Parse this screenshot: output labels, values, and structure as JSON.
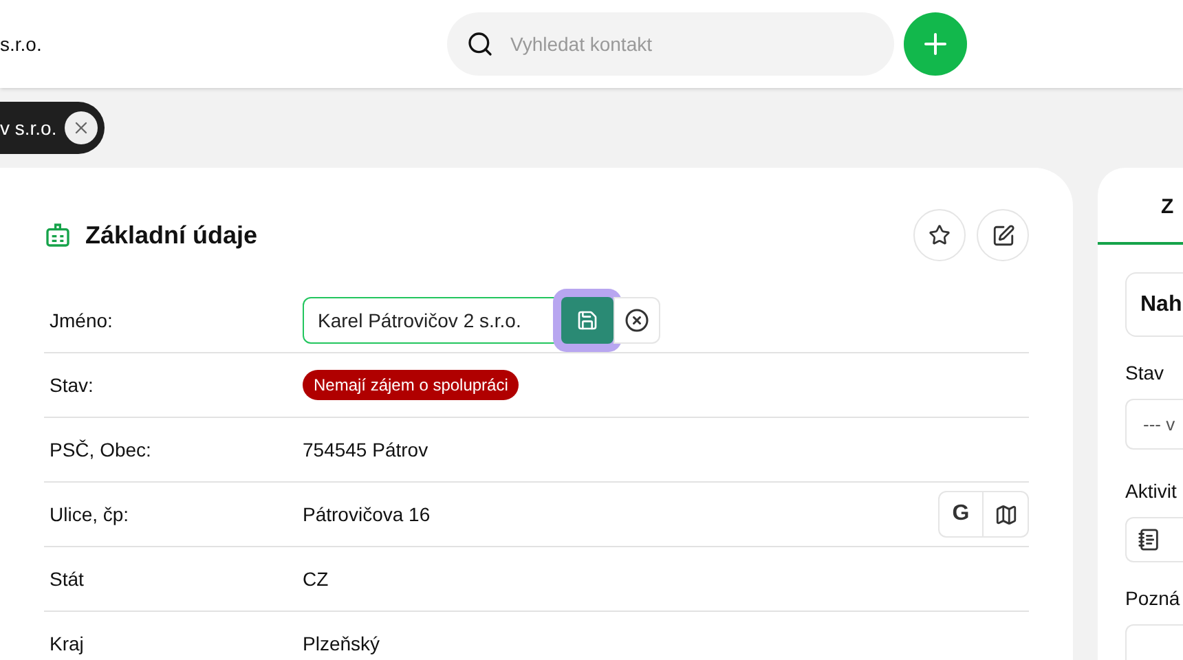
{
  "header": {
    "title": "s.r.o.",
    "search": {
      "placeholder": "Vyhledat kontakt"
    }
  },
  "chips": [
    {
      "label": "v s.r.o."
    }
  ],
  "card": {
    "title": "Základní údaje",
    "rows": [
      {
        "kind": "input",
        "label": "Jméno:",
        "value": "Karel Pátrovičov 2 s.r.o."
      },
      {
        "kind": "badge",
        "label": "Stav:",
        "value": "Nemají zájem o spolupráci",
        "color": "#b00000"
      },
      {
        "kind": "text",
        "label": "PSČ, Obec:",
        "value": "754545 Pátrov"
      },
      {
        "kind": "address",
        "label": "Ulice, čp:",
        "value": "Pátrovičova 16",
        "google": "G"
      },
      {
        "kind": "text",
        "label": "Stát",
        "value": "CZ"
      },
      {
        "kind": "text",
        "label": "Kraj",
        "value": "Plzeňský"
      }
    ]
  },
  "side_panel": {
    "tab": {
      "label": "Z",
      "selected": true
    },
    "heading": "Nah",
    "status_label": "Stav",
    "status_select": "--- v",
    "activity_label": "Aktivit",
    "note_label": "Pozná"
  }
}
